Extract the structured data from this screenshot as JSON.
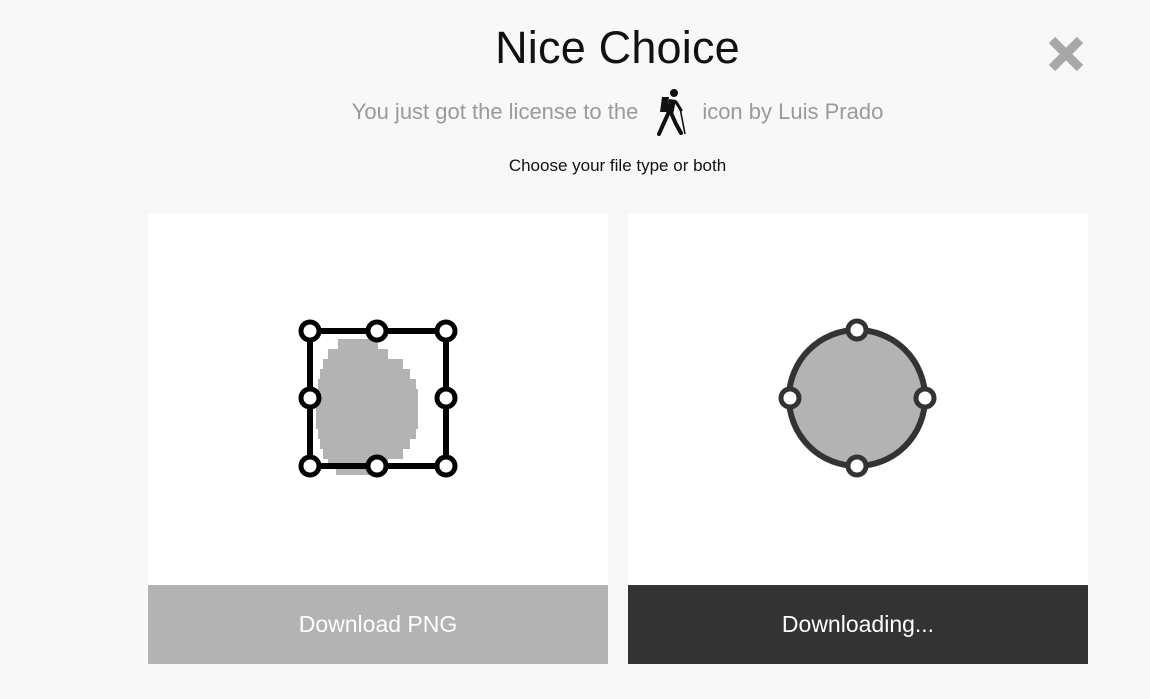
{
  "header": {
    "title": "Nice Choice",
    "subtitle_prefix": "You just got the license to the",
    "subtitle_suffix": "icon by Luis Prado",
    "instruction": "Choose your file type or both",
    "licensed_icon": "hiker-icon",
    "close_icon": "close-icon"
  },
  "options": {
    "png": {
      "icon": "png-raster-icon",
      "button_label": "Download PNG"
    },
    "svg": {
      "icon": "svg-vector-icon",
      "button_label": "Downloading..."
    }
  },
  "colors": {
    "background": "#f8f8f8",
    "png_button": "#b3b3b3",
    "svg_button": "#333333",
    "muted_text": "#9a9a9a",
    "close": "#a8a8a8"
  }
}
